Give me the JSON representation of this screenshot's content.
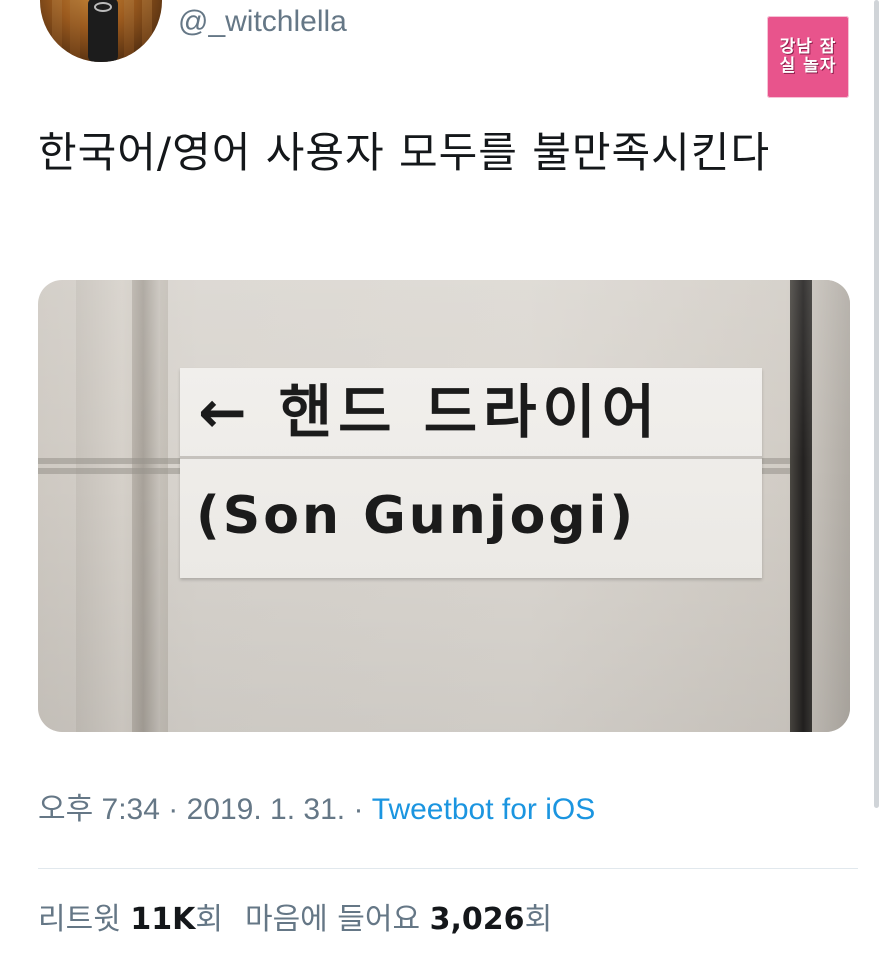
{
  "author": {
    "handle": "@_witchlella"
  },
  "watermark": {
    "text": "강남 잠실 놀자"
  },
  "tweet": {
    "text": "한국어/영어 사용자 모두를 불만족시킨다"
  },
  "photo": {
    "sign_line1": "← 핸드 드라이어",
    "sign_line2": "(Son Gunjogi)"
  },
  "meta": {
    "time": "오후 7:34",
    "date": "2019. 1. 31.",
    "separator": "·",
    "source": "Tweetbot for iOS"
  },
  "stats": {
    "retweets_label": "리트윗",
    "retweets_count": "11K",
    "retweets_unit": "회",
    "likes_label": "마음에 들어요",
    "likes_count": "3,026",
    "likes_unit": "회"
  },
  "colors": {
    "text": "#14171a",
    "secondary": "#657786",
    "link": "#1b95e0",
    "watermark_bg": "#e8548c"
  }
}
